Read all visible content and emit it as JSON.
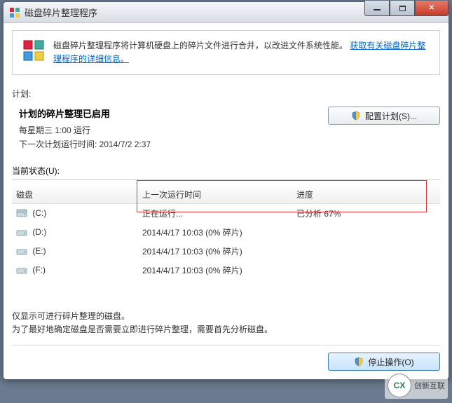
{
  "window": {
    "title": "磁盘碎片整理程序"
  },
  "info": {
    "text": "磁盘碎片整理程序将计算机硬盘上的碎片文件进行合并，以改进文件系统性能。",
    "link": "获取有关磁盘碎片整理程序的详细信息。"
  },
  "plan_label": "计划:",
  "schedule": {
    "title": "计划的碎片整理已启用",
    "line1": "每星期三 1:00 运行",
    "line2": "下一次计划运行时间: 2014/7/2 2:37"
  },
  "config_button": "配置计划(S)...",
  "status_label": "当前状态(U):",
  "columns": {
    "disk": "磁盘",
    "last_run": "上一次运行时间",
    "progress": "进度"
  },
  "rows": [
    {
      "name": "(C:)",
      "last_run": "正在运行...",
      "progress": "已分析 67%",
      "icon": "hdd"
    },
    {
      "name": "(D:)",
      "last_run": "2014/4/17 10:03 (0% 碎片)",
      "progress": "",
      "icon": "hdd"
    },
    {
      "name": "(E:)",
      "last_run": "2014/4/17 10:03 (0% 碎片)",
      "progress": "",
      "icon": "hdd"
    },
    {
      "name": "(F:)",
      "last_run": "2014/4/17 10:03 (0% 碎片)",
      "progress": "",
      "icon": "hdd"
    }
  ],
  "hint1": "仅显示可进行碎片整理的磁盘。",
  "hint2": "为了最好地确定磁盘是否需要立即进行碎片整理，需要首先分析磁盘。",
  "stop_button": "停止操作(O)",
  "watermark": "创新互联"
}
